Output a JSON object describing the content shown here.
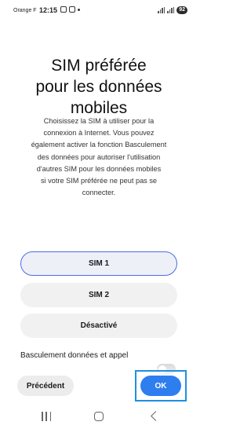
{
  "status_bar": {
    "carrier": "Orange F",
    "time": "12:15",
    "battery": "92"
  },
  "title_lines": [
    "SIM préférée",
    "pour les données",
    "mobiles"
  ],
  "description_lines": [
    "Choisissez la SIM à utiliser pour la",
    "connexion à Internet. Vous pouvez",
    "également activer la fonction Basculement",
    "des données pour autoriser l'utilisation",
    "d'autres SIM pour les données mobiles",
    "si votre SIM préférée ne peut pas se",
    "connecter."
  ],
  "options": [
    {
      "label": "SIM 1",
      "selected": true
    },
    {
      "label": "SIM 2",
      "selected": false
    },
    {
      "label": "Désactivé",
      "selected": false
    }
  ],
  "switch": {
    "label": "Basculement données et appel",
    "on": false
  },
  "buttons": {
    "previous": "Précédent",
    "ok": "OK"
  },
  "colors": {
    "accent": "#2e7ef0",
    "selected_border": "#4a6ee0",
    "highlight": "#1e8fe0"
  },
  "icons": {
    "nav_recents": "recents-icon",
    "nav_home": "home-icon",
    "nav_back": "back-icon"
  }
}
